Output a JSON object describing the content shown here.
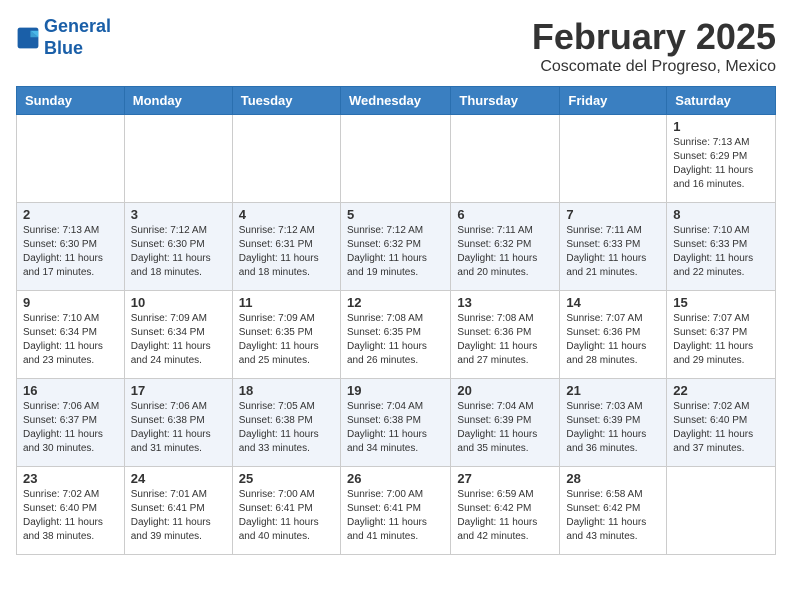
{
  "logo": {
    "line1": "General",
    "line2": "Blue"
  },
  "title": "February 2025",
  "subtitle": "Coscomate del Progreso, Mexico",
  "weekdays": [
    "Sunday",
    "Monday",
    "Tuesday",
    "Wednesday",
    "Thursday",
    "Friday",
    "Saturday"
  ],
  "weeks": [
    [
      {
        "day": "",
        "info": ""
      },
      {
        "day": "",
        "info": ""
      },
      {
        "day": "",
        "info": ""
      },
      {
        "day": "",
        "info": ""
      },
      {
        "day": "",
        "info": ""
      },
      {
        "day": "",
        "info": ""
      },
      {
        "day": "1",
        "info": "Sunrise: 7:13 AM\nSunset: 6:29 PM\nDaylight: 11 hours and 16 minutes."
      }
    ],
    [
      {
        "day": "2",
        "info": "Sunrise: 7:13 AM\nSunset: 6:30 PM\nDaylight: 11 hours and 17 minutes."
      },
      {
        "day": "3",
        "info": "Sunrise: 7:12 AM\nSunset: 6:30 PM\nDaylight: 11 hours and 18 minutes."
      },
      {
        "day": "4",
        "info": "Sunrise: 7:12 AM\nSunset: 6:31 PM\nDaylight: 11 hours and 18 minutes."
      },
      {
        "day": "5",
        "info": "Sunrise: 7:12 AM\nSunset: 6:32 PM\nDaylight: 11 hours and 19 minutes."
      },
      {
        "day": "6",
        "info": "Sunrise: 7:11 AM\nSunset: 6:32 PM\nDaylight: 11 hours and 20 minutes."
      },
      {
        "day": "7",
        "info": "Sunrise: 7:11 AM\nSunset: 6:33 PM\nDaylight: 11 hours and 21 minutes."
      },
      {
        "day": "8",
        "info": "Sunrise: 7:10 AM\nSunset: 6:33 PM\nDaylight: 11 hours and 22 minutes."
      }
    ],
    [
      {
        "day": "9",
        "info": "Sunrise: 7:10 AM\nSunset: 6:34 PM\nDaylight: 11 hours and 23 minutes."
      },
      {
        "day": "10",
        "info": "Sunrise: 7:09 AM\nSunset: 6:34 PM\nDaylight: 11 hours and 24 minutes."
      },
      {
        "day": "11",
        "info": "Sunrise: 7:09 AM\nSunset: 6:35 PM\nDaylight: 11 hours and 25 minutes."
      },
      {
        "day": "12",
        "info": "Sunrise: 7:08 AM\nSunset: 6:35 PM\nDaylight: 11 hours and 26 minutes."
      },
      {
        "day": "13",
        "info": "Sunrise: 7:08 AM\nSunset: 6:36 PM\nDaylight: 11 hours and 27 minutes."
      },
      {
        "day": "14",
        "info": "Sunrise: 7:07 AM\nSunset: 6:36 PM\nDaylight: 11 hours and 28 minutes."
      },
      {
        "day": "15",
        "info": "Sunrise: 7:07 AM\nSunset: 6:37 PM\nDaylight: 11 hours and 29 minutes."
      }
    ],
    [
      {
        "day": "16",
        "info": "Sunrise: 7:06 AM\nSunset: 6:37 PM\nDaylight: 11 hours and 30 minutes."
      },
      {
        "day": "17",
        "info": "Sunrise: 7:06 AM\nSunset: 6:38 PM\nDaylight: 11 hours and 31 minutes."
      },
      {
        "day": "18",
        "info": "Sunrise: 7:05 AM\nSunset: 6:38 PM\nDaylight: 11 hours and 33 minutes."
      },
      {
        "day": "19",
        "info": "Sunrise: 7:04 AM\nSunset: 6:38 PM\nDaylight: 11 hours and 34 minutes."
      },
      {
        "day": "20",
        "info": "Sunrise: 7:04 AM\nSunset: 6:39 PM\nDaylight: 11 hours and 35 minutes."
      },
      {
        "day": "21",
        "info": "Sunrise: 7:03 AM\nSunset: 6:39 PM\nDaylight: 11 hours and 36 minutes."
      },
      {
        "day": "22",
        "info": "Sunrise: 7:02 AM\nSunset: 6:40 PM\nDaylight: 11 hours and 37 minutes."
      }
    ],
    [
      {
        "day": "23",
        "info": "Sunrise: 7:02 AM\nSunset: 6:40 PM\nDaylight: 11 hours and 38 minutes."
      },
      {
        "day": "24",
        "info": "Sunrise: 7:01 AM\nSunset: 6:41 PM\nDaylight: 11 hours and 39 minutes."
      },
      {
        "day": "25",
        "info": "Sunrise: 7:00 AM\nSunset: 6:41 PM\nDaylight: 11 hours and 40 minutes."
      },
      {
        "day": "26",
        "info": "Sunrise: 7:00 AM\nSunset: 6:41 PM\nDaylight: 11 hours and 41 minutes."
      },
      {
        "day": "27",
        "info": "Sunrise: 6:59 AM\nSunset: 6:42 PM\nDaylight: 11 hours and 42 minutes."
      },
      {
        "day": "28",
        "info": "Sunrise: 6:58 AM\nSunset: 6:42 PM\nDaylight: 11 hours and 43 minutes."
      },
      {
        "day": "",
        "info": ""
      }
    ]
  ]
}
